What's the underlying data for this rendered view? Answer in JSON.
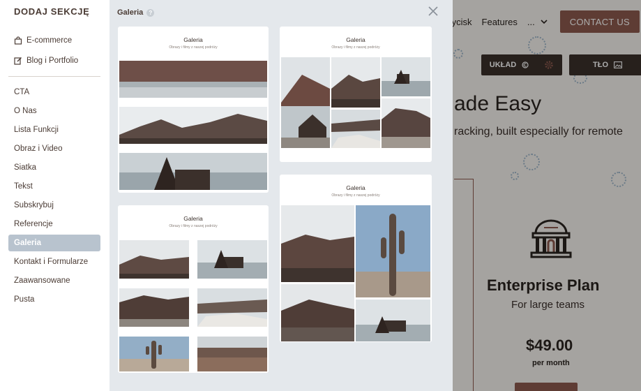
{
  "background": {
    "nav": {
      "link_przycisk": "Przycisk",
      "link_features": "Features",
      "more": "...",
      "contact": "CONTACT US"
    },
    "tools": {
      "uklad": "UKŁAD",
      "tlo": "TŁO"
    },
    "heading": "ade Easy",
    "subheading": "racking, built especially for remote",
    "plan_title": "Enterprise Plan",
    "plan_sub": "For large teams",
    "price": "$49.00",
    "per": "per month"
  },
  "sidebar": {
    "title": "DODAJ SEKCJĘ",
    "top_items": [
      {
        "label": "E-commerce",
        "icon": "shopping-bag-icon"
      },
      {
        "label": "Blog i Portfolio",
        "icon": "edit-icon"
      }
    ],
    "items": [
      {
        "label": "CTA"
      },
      {
        "label": "O Nas"
      },
      {
        "label": "Lista Funkcji"
      },
      {
        "label": "Obraz i Video"
      },
      {
        "label": "Siatka"
      },
      {
        "label": "Tekst"
      },
      {
        "label": "Subskrybuj"
      },
      {
        "label": "Referencje"
      },
      {
        "label": "Galeria",
        "active": true
      },
      {
        "label": "Kontakt i Formularze"
      },
      {
        "label": "Zaawansowane"
      },
      {
        "label": "Pusta"
      }
    ]
  },
  "content": {
    "title": "Galeria",
    "templates": [
      {
        "title": "Galeria",
        "subtitle": "Obrazy i filmy z naszej podróży"
      },
      {
        "title": "Galeria",
        "subtitle": "Obrazy i filmy z naszej podróży"
      },
      {
        "title": "Galeria",
        "subtitle": "Obrazy i filmy z naszej podróży"
      },
      {
        "title": "Galeria",
        "subtitle": "Obrazy i filmy z naszej podróży"
      }
    ]
  },
  "colors": {
    "accent": "#8d5a4e",
    "active_item": "#b8c3ce",
    "dark_tool": "#3b302b"
  }
}
